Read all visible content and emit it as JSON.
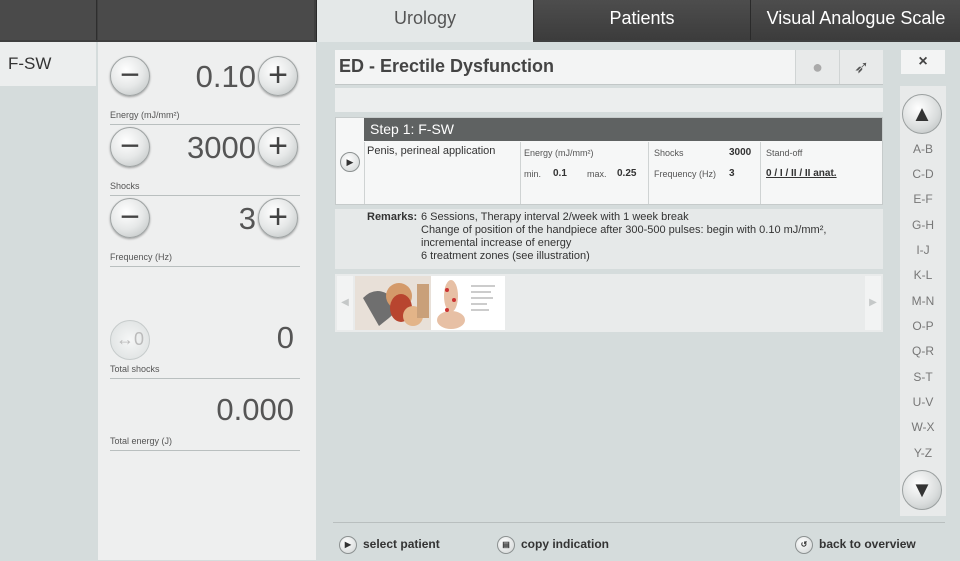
{
  "tabs": [
    {
      "label": "Urology",
      "active": true
    },
    {
      "label": "Patients",
      "active": false
    },
    {
      "label": "Visual Analogue Scale",
      "active": false
    }
  ],
  "sidebar": {
    "mode_tab": "F-SW"
  },
  "params": {
    "energy": {
      "value": "0.10",
      "label": "Energy (mJ/mm²)"
    },
    "shocks": {
      "value": "3000",
      "label": "Shocks"
    },
    "frequency": {
      "value": "3",
      "label": "Frequency (Hz)"
    },
    "total_shocks": {
      "value": "0",
      "label": "Total shocks"
    },
    "total_energy": {
      "value": "0.000",
      "label": "Total energy (J)"
    }
  },
  "indication": {
    "title": "ED - Erectile Dysfunction",
    "close_symbol": "×",
    "step": {
      "heading": "Step 1:  F-SW",
      "application": "Penis, perineal application",
      "energy_label": "Energy (mJ/mm²)",
      "min_label": "min.",
      "min_value": "0.1",
      "max_label": "max.",
      "max_value": "0.25",
      "shocks_label": "Shocks",
      "shocks_value": "3000",
      "freq_label": "Frequency (Hz)",
      "freq_value": "3",
      "standoff_label": "Stand-off",
      "standoff_value": "0 / I / II / II anat."
    },
    "remarks": {
      "label": "Remarks:",
      "lines": [
        "6 Sessions, Therapy interval 2/week with 1 week break",
        "Change of position of the handpiece after 300-500 pulses: begin with 0.10 mJ/mm²,",
        "incremental increase of energy",
        "6 treatment zones (see illustration)"
      ]
    }
  },
  "alphabet": [
    "A-B",
    "C-D",
    "E-F",
    "G-H",
    "I-J",
    "K-L",
    "M-N",
    "O-P",
    "Q-R",
    "S-T",
    "U-V",
    "W-X",
    "Y-Z"
  ],
  "bottom": {
    "select_patient": "select patient",
    "copy_indication": "copy indication",
    "back_to_overview": "back to overview"
  },
  "colors": {
    "step_header": "#5f6262",
    "background": "#d5dcdc",
    "panel": "#eeefef"
  }
}
